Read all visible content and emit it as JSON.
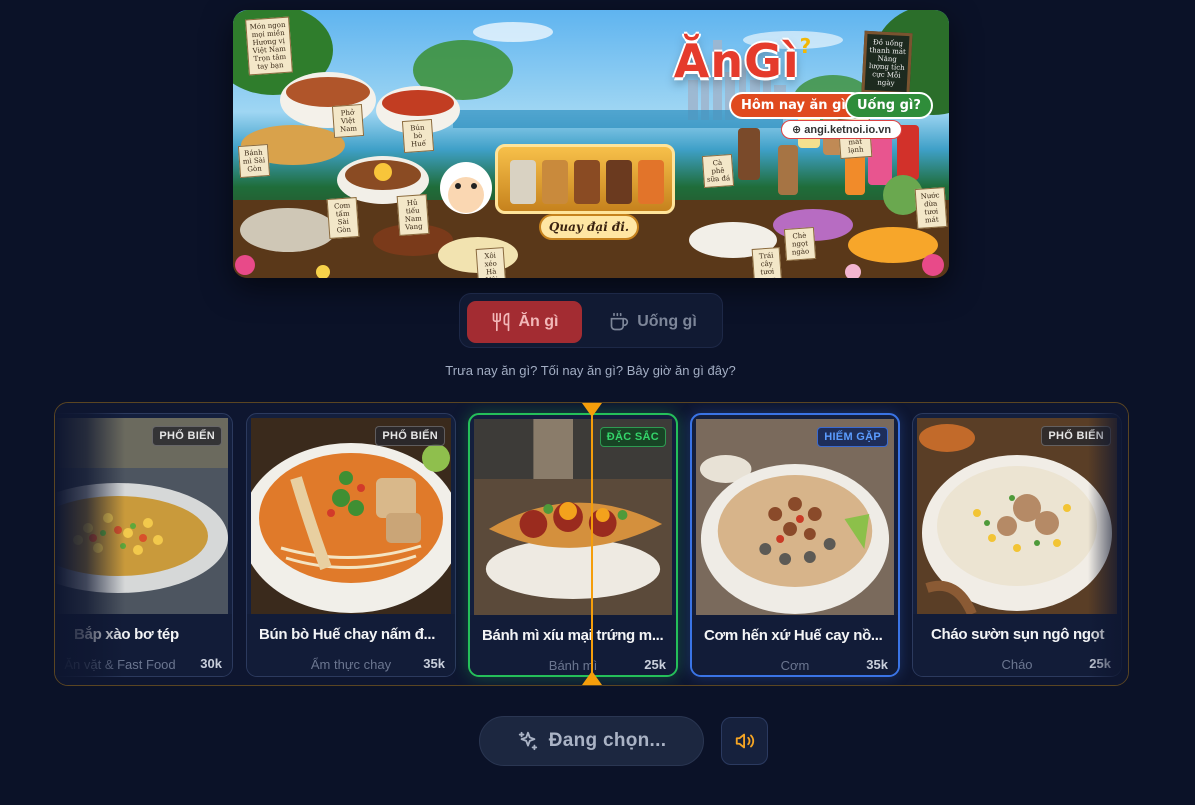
{
  "banner": {
    "logo_text": "ĂnGì",
    "logo_question": "?",
    "pill_eat": "Hôm nay ăn gì?",
    "pill_drink": "Uống gì?",
    "url": "angi.ketnoi.io.vn",
    "spin_label": "Quay đại đi.",
    "note_left": "Món ngon mọi miền Hương vị Việt Nam Trọn tâm tay bạn",
    "note_pho": "Phở Việt Nam",
    "note_bunbo": "Bún bò Huế",
    "note_banhmi": "Bánh mì Sài Gòn",
    "note_comtam": "Cơm tấm Sài Gòn",
    "note_hutieu": "Hủ tiếu Nam Vang",
    "note_xoi": "Xôi xéo Hà Nội",
    "chalk_right": "Đồ uống thanh mát Năng lượng tích cực Mỗi ngày",
    "note_caphe": "Cà phê sữa đá",
    "note_nuocmia": "Nước mía mát lạnh",
    "note_che": "Chè ngọt ngào",
    "note_traicay": "Trái cây tươi ngon",
    "note_nuocdua": "Nước dừa tươi mát"
  },
  "tabs": [
    {
      "label": "Ăn gì",
      "icon": "utensils-icon",
      "active": true
    },
    {
      "label": "Uống gì",
      "icon": "cup-icon",
      "active": false
    }
  ],
  "subtitle": "Trưa nay ăn gì? Tối nay ăn gì? Bây giờ ăn gì đây?",
  "cards": [
    {
      "name": "Bắp xào bơ tép",
      "category": "Ăn vặt & Fast Food",
      "price": "30k",
      "badge": "PHỔ BIẾN",
      "badge_type": "popular"
    },
    {
      "name": "Bún bò Huế chay nấm đ...",
      "category": "Ẩm thực chay",
      "price": "35k",
      "badge": "PHỔ BIẾN",
      "badge_type": "popular"
    },
    {
      "name": "Bánh mì xíu mại trứng m...",
      "category": "Bánh mì",
      "price": "25k",
      "badge": "ĐẶC SẮC",
      "badge_type": "featured"
    },
    {
      "name": "Cơm hến xứ Huế cay nồ...",
      "category": "Cơm",
      "price": "35k",
      "badge": "HIẾM GẶP",
      "badge_type": "rare"
    },
    {
      "name": "Cháo sườn sụn ngô ngọt",
      "category": "Cháo",
      "price": "25k",
      "badge": "PHỔ BIẾN",
      "badge_type": "popular"
    }
  ],
  "spin_button": {
    "label": "Đang chọn...",
    "icon": "sparkles-icon"
  },
  "sound_button": {
    "icon": "speaker-icon"
  },
  "colors": {
    "background": "#0b1228",
    "accent_red": "#a32c32",
    "pointer": "#f59e0b",
    "featured": "#25c05a",
    "rare": "#3a74e6"
  }
}
